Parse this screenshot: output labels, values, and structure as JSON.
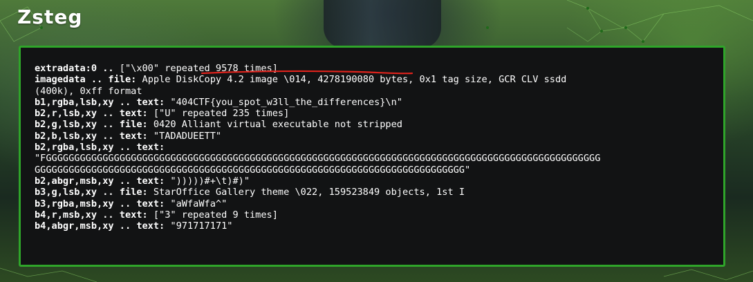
{
  "page": {
    "title": "Zsteg"
  },
  "output_lines": [
    {
      "key": "extradata:0 ..",
      "rest": " [\"\\x00\" repeated 9578 times]"
    },
    {
      "key": "imagedata .. file:",
      "rest": " Apple DiskCopy 4.2 image \\014, 4278190080 bytes, 0x1 tag size, GCR CLV ssdd"
    },
    {
      "key": "",
      "rest": "(400k), 0xff format"
    },
    {
      "key": "b1,rgba,lsb,xy .. text:",
      "rest": " \"404CTF{you_spot_w3ll_the_differences}\\n\""
    },
    {
      "key": "b2,r,lsb,xy .. text:",
      "rest": " [\"U\" repeated 235 times]"
    },
    {
      "key": "b2,g,lsb,xy .. file:",
      "rest": " 0420 Alliant virtual executable not stripped"
    },
    {
      "key": "b2,b,lsb,xy .. text:",
      "rest": " \"TADADUEETT\""
    },
    {
      "key": "b2,rgba,lsb,xy .. text:",
      "rest": ""
    },
    {
      "key": "",
      "rest": "\"FGGGGGGGGGGGGGGGGGGGGGGGGGGGGGGGGGGGGGGGGGGGGGGGGGGGGGGGGGGGGGGGGGGGGGGGGGGGGGGGGGGGGGGGGGGGGGGGGGG"
    },
    {
      "key": "",
      "rest": "GGGGGGGGGGGGGGGGGGGGGGGGGGGGGGGGGGGGGGGGGGGGGGGGGGGGGGGGGGGGGGGGGGGGGGGGGGGG\""
    },
    {
      "key": "b2,abgr,msb,xy .. text:",
      "rest": " \")))))#+\\t)#)\""
    },
    {
      "key": "b3,g,lsb,xy .. file:",
      "rest": " StarOffice Gallery theme \\022, 159523849 objects, 1st I"
    },
    {
      "key": "b3,rgba,msb,xy .. text:",
      "rest": " \"aWfaWfa^\""
    },
    {
      "key": "b4,r,msb,xy .. text:",
      "rest": " [\"3\" repeated 9 times]"
    },
    {
      "key": "b4,abgr,msb,xy .. text:",
      "rest": " \"971717171\""
    }
  ],
  "colors": {
    "terminal_border": "#2fa52a",
    "terminal_bg": "#121314",
    "highlight_underline": "#e0231c"
  }
}
